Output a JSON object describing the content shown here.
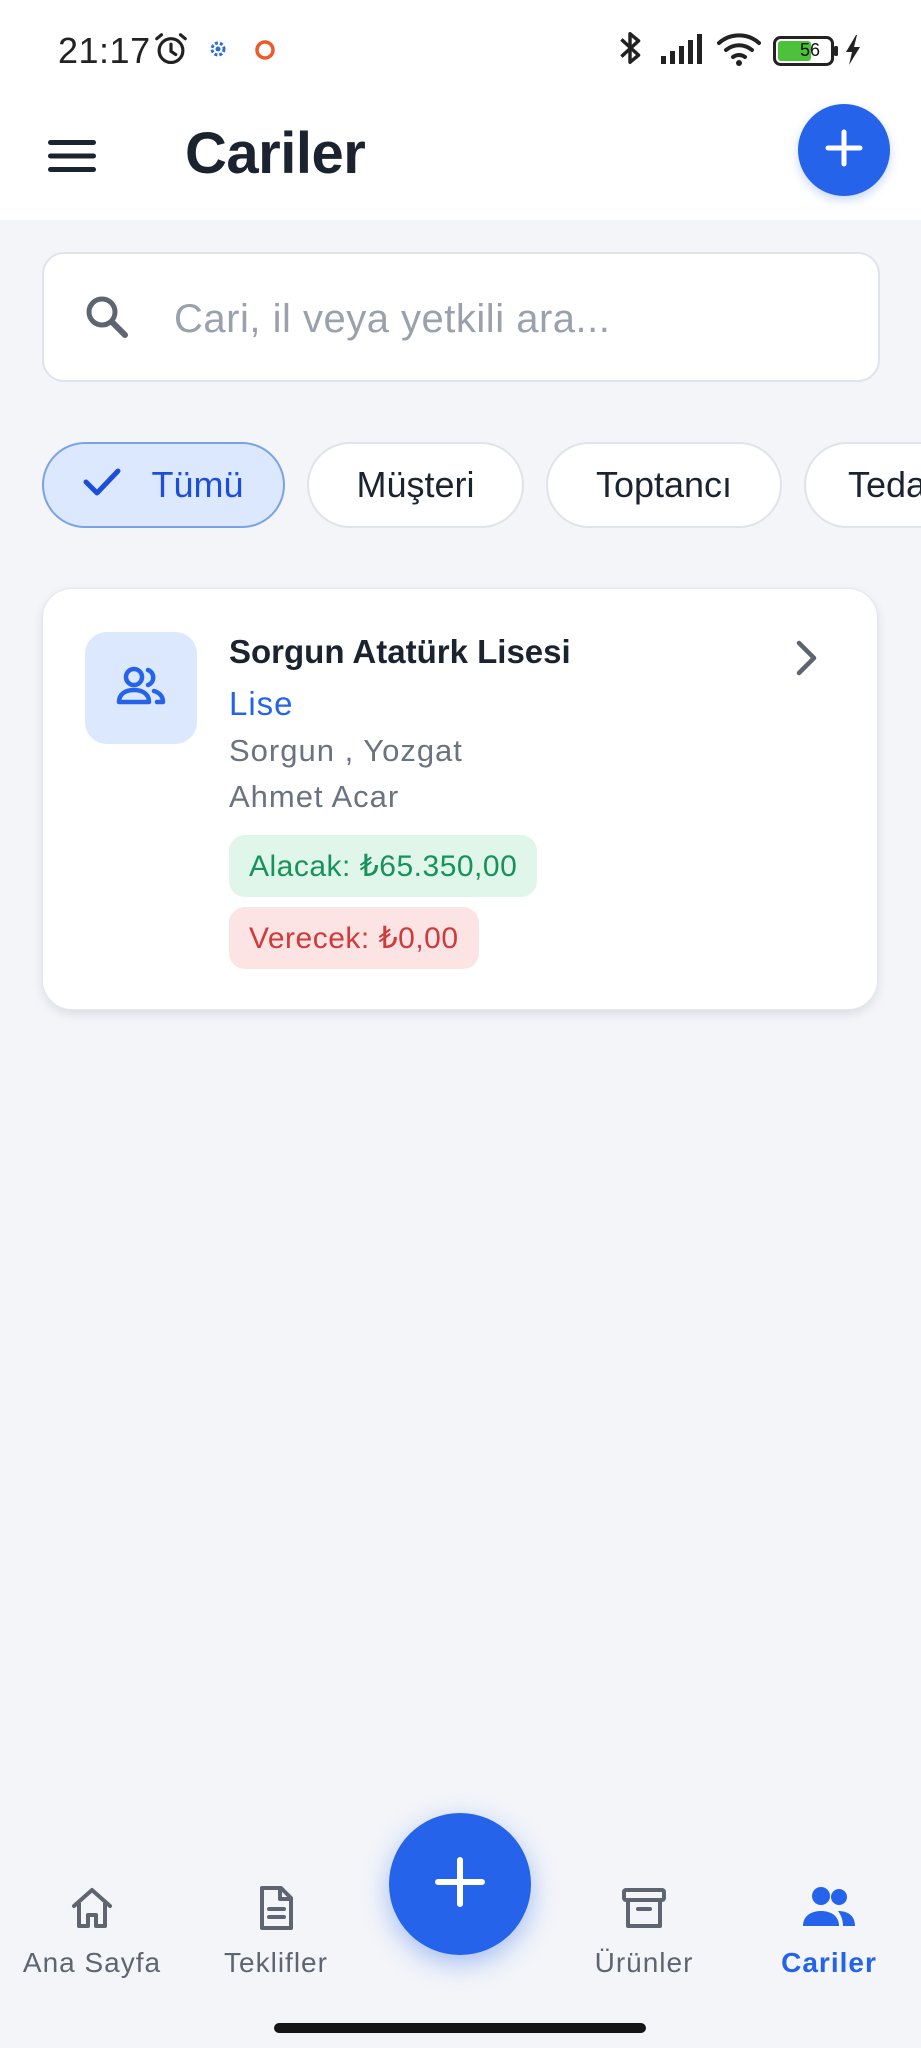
{
  "status_bar": {
    "time": "21:17",
    "battery_level": "56",
    "icons": [
      "alarm-icon",
      "app-notification-icon",
      "record-icon",
      "bluetooth-icon",
      "signal-icon",
      "wifi-icon",
      "battery-icon",
      "charging-icon"
    ]
  },
  "app_bar": {
    "title": "Cariler",
    "menu_icon": "menu-icon",
    "add_icon": "plus-icon"
  },
  "search": {
    "placeholder": "Cari, il veya yetkili ara...",
    "value": ""
  },
  "filters": {
    "selected": "Tümü",
    "items": [
      {
        "label": "Tümü",
        "selected": true
      },
      {
        "label": "Müşteri",
        "selected": false
      },
      {
        "label": "Toptancı",
        "selected": false
      },
      {
        "label": "Teda",
        "selected": false
      }
    ]
  },
  "accounts": [
    {
      "name": "Sorgun Atatürk Lisesi",
      "type": "Lise",
      "location": "Sorgun , Yozgat",
      "contact": "Ahmet Acar",
      "receivable": "Alacak: ₺65.350,00",
      "payable": "Verecek: ₺0,00"
    }
  ],
  "bottom_nav": {
    "items": [
      {
        "label": "Ana Sayfa",
        "icon": "home-icon",
        "active": false
      },
      {
        "label": "Teklifler",
        "icon": "document-icon",
        "active": false
      },
      {
        "label": "Ürünler",
        "icon": "archive-box-icon",
        "active": false
      },
      {
        "label": "Cariler",
        "icon": "users-icon",
        "active": true
      }
    ],
    "fab_icon": "plus-icon"
  },
  "colors": {
    "accent": "#2563eb",
    "background": "#f3f5f9",
    "receivable_bg": "#e1f6ea",
    "receivable_text": "#15935a",
    "payable_bg": "#fde4e4",
    "payable_text": "#d03a3a"
  }
}
